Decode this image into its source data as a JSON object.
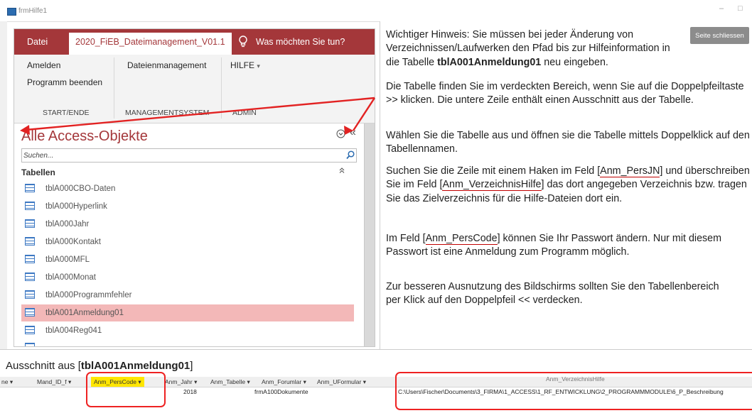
{
  "window": {
    "title": "frmHilfe1",
    "minimize_glyph": "–",
    "maximize_glyph": "□"
  },
  "ribbon": {
    "tabs": [
      "Datei",
      "2020_FiEB_Dateimanagement_V01.1",
      "Was möchten Sie tun?"
    ],
    "tell_me_icon": "lightbulb-icon",
    "items": {
      "anmelden": "Amelden",
      "programm_beenden": "Programm beenden",
      "dateienmanagement": "Dateienmanagement",
      "hilfe": "HILFE",
      "hilfe_arrow": "▾"
    },
    "groups": [
      "START/ENDE",
      "MANAGEMENTSYSTEM",
      "ADMIN"
    ]
  },
  "nav_pane": {
    "title": "Alle Access-Objekte",
    "search_placeholder": "Suchen...",
    "section": "Tabellen",
    "items": [
      {
        "label": "tblA000CBO-Daten",
        "selected": false
      },
      {
        "label": "tblA000Hyperlink",
        "selected": false
      },
      {
        "label": "tblA000Jahr",
        "selected": false
      },
      {
        "label": "tblA000Kontakt",
        "selected": false
      },
      {
        "label": "tblA000MFL",
        "selected": false
      },
      {
        "label": "tblA000Monat",
        "selected": false
      },
      {
        "label": "tblA000Programmfehler",
        "selected": false
      },
      {
        "label": "tblA001Anmeldung01",
        "selected": true
      },
      {
        "label": "tblA004Reg041",
        "selected": false
      }
    ]
  },
  "help": {
    "close_button": "Seite schliessen",
    "p1": {
      "before": "Wichtiger Hinweis: Sie müssen bei jeder Änderung von Verzeichnissen/Laufwerken den Pfad bis zur Hilfeinformation in die Tabelle ",
      "bold": "tblA001Anmeldung01",
      "after": " neu eingeben."
    },
    "p2": "Die Tabelle finden Sie im verdeckten Bereich, wenn Sie auf die Doppelpfeiltaste >> klicken. Die untere Zeile enthält einen Ausschnitt aus der Tabelle.",
    "p3": "Wählen Sie die Tabelle aus und öffnen sie die Tabelle mittels Doppelklick auf den Tabellennamen.",
    "p4": {
      "t1": "Suchen Sie die Zeile mit einem Haken im Feld [",
      "f1": "Anm_PersJN",
      "t2": "] und überschreiben Sie im Feld [",
      "f2": "Anm_VerzeichnisHilfe",
      "t3": "] das dort angegeben Verzeichnis bzw. tragen Sie das Zielverzeichnis für die Hilfe-Dateien dort ein."
    },
    "p5": {
      "t1": "Im Feld [",
      "f1": "Anm_PersCode",
      "t2": "] können Sie Ihr Passwort ändern. Nur mit diesem Passwort ist eine Anmeldung zum Programm möglich."
    },
    "p6": "Zur besseren Ausnutzung des Bildschirms sollten Sie den Tabellenbereich per Klick auf den Doppelpfeil << verdecken."
  },
  "excerpt": {
    "title_prefix": "Ausschnitt aus [",
    "title_bold": "tblA001Anmeldung01",
    "title_suffix": "]",
    "headers": [
      "ne",
      "Mand_ID_f",
      "Anm_PersCode",
      "Anm_Jahr",
      "Anm_Tabelle",
      "Anm_Forumlar",
      "Anm_UFormular",
      "Anm_VerzeichnisHilfe"
    ],
    "sort_glyph": "▾",
    "row": {
      "jahr": "2018",
      "formular": "frmA100Dokumente",
      "verzeichnis": "C:\\Users\\Fischer\\Documents\\3_FIRMA\\1_ACCESS\\1_RF_ENTWICKLUNG\\2_PROGRAMMMODULE\\6_P_Beschreibung"
    }
  },
  "colors": {
    "accent": "#a4373a",
    "annotation": "#e22222",
    "highlight": "#ffe600",
    "selection": "#f3b8b8"
  }
}
